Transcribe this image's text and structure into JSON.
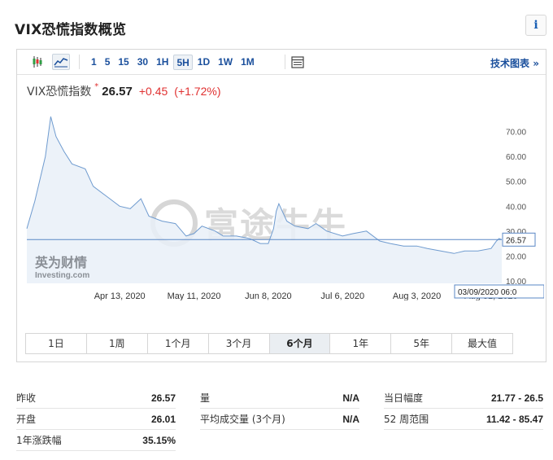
{
  "page_title": "VIX恐慌指数概览",
  "info_icon": "i",
  "toolbar": {
    "candlestick_icon": "candlestick-icon",
    "line_chart_icon": "line-chart-icon",
    "intervals": [
      "1",
      "5",
      "15",
      "30",
      "1H",
      "5H",
      "1D",
      "1W",
      "1M"
    ],
    "active_interval": "5H",
    "table_icon": "table-icon",
    "tech_chart_label": "技术图表",
    "tech_chart_arrow": "»"
  },
  "quote": {
    "name": "VIX恐慌指数",
    "star": "*",
    "price": "26.57",
    "change": "+0.45",
    "change_pct": "(+1.72%)"
  },
  "chart_data": {
    "type": "area",
    "title": "",
    "x": [
      "2020-03-09",
      "2020-03-12",
      "2020-03-16",
      "2020-03-18",
      "2020-03-20",
      "2020-03-23",
      "2020-03-26",
      "2020-03-31",
      "2020-04-03",
      "2020-04-08",
      "2020-04-13",
      "2020-04-17",
      "2020-04-21",
      "2020-04-24",
      "2020-04-29",
      "2020-05-04",
      "2020-05-08",
      "2020-05-11",
      "2020-05-14",
      "2020-05-19",
      "2020-05-22",
      "2020-05-27",
      "2020-06-01",
      "2020-06-05",
      "2020-06-08",
      "2020-06-10",
      "2020-06-11",
      "2020-06-12",
      "2020-06-15",
      "2020-06-18",
      "2020-06-23",
      "2020-06-26",
      "2020-06-30",
      "2020-07-06",
      "2020-07-10",
      "2020-07-15",
      "2020-07-20",
      "2020-07-24",
      "2020-07-29",
      "2020-08-03",
      "2020-08-07",
      "2020-08-12",
      "2020-08-17",
      "2020-08-21",
      "2020-08-26",
      "2020-08-31",
      "2020-09-02",
      "2020-09-03",
      "2020-09-04"
    ],
    "y": [
      31,
      42,
      60,
      76,
      68,
      62,
      57,
      55,
      48,
      44,
      40,
      39,
      43,
      36,
      34,
      33,
      28,
      29,
      32,
      30,
      28,
      28,
      27,
      25,
      25,
      31,
      38,
      41,
      34,
      32,
      31,
      33,
      30,
      28,
      29,
      30,
      26,
      25,
      24,
      24,
      23,
      22,
      21,
      22,
      22,
      23,
      26,
      27,
      26.57
    ],
    "xlabel": "",
    "ylabel": "",
    "x_tick_labels": [
      "Apr 13, 2020",
      "May 11, 2020",
      "Jun 8, 2020",
      "Jul 6, 2020",
      "Aug 3, 2020",
      "Aug 31, 2020"
    ],
    "y_ticks": [
      10,
      20,
      30,
      40,
      50,
      60,
      70
    ],
    "y_tick_labels": [
      "10.00",
      "20.00",
      "30.00",
      "40.00",
      "50.00",
      "60.00",
      "70.00"
    ],
    "ylim": [
      9,
      80
    ],
    "last_value_label": "26.57",
    "crosshair_date_label": "03/09/2020 06:0",
    "grid": false,
    "watermark": "富途牛牛",
    "logo_text": "英为财情",
    "logo_sub": "Investing.com",
    "line_color": "#6f9bcf",
    "fill_color": "#e9f0f8"
  },
  "range_tabs": [
    "1日",
    "1周",
    "1个月",
    "3个月",
    "6个月",
    "1年",
    "5年",
    "最大值"
  ],
  "active_range": "6个月",
  "stats": {
    "col1": [
      {
        "label": "昨收",
        "value": "26.57"
      },
      {
        "label": "开盘",
        "value": "26.01"
      },
      {
        "label": "1年涨跌幅",
        "value": "35.15%"
      }
    ],
    "col2": [
      {
        "label": "量",
        "value": "N/A"
      },
      {
        "label": "平均成交量 (3个月)",
        "value": "N/A"
      }
    ],
    "col3": [
      {
        "label": "当日幅度",
        "value": "21.77 - 26.5"
      },
      {
        "label": "52 周范围",
        "value": "11.42 - 85.47"
      }
    ]
  }
}
